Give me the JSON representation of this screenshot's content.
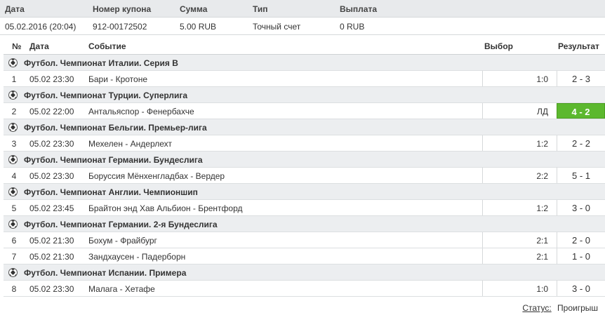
{
  "coupon": {
    "headers": {
      "date": "Дата",
      "number": "Номер купона",
      "sum": "Сумма",
      "type": "Тип",
      "payout": "Выплата"
    },
    "values": {
      "date": "05.02.2016 (20:04)",
      "number": "912-00172502",
      "sum": "5.00 RUB",
      "type": "Точный счет",
      "payout": "0 RUB"
    }
  },
  "events_table": {
    "headers": {
      "num": "№",
      "date": "Дата",
      "event": "Событие",
      "choice": "Выбор",
      "result": "Результат"
    },
    "groups": [
      {
        "title": "Футбол. Чемпионат Италии. Серия В",
        "matches": [
          {
            "num": "1",
            "date": "05.02 23:30",
            "event": "Бари - Кротоне",
            "choice": "1:0",
            "result": "2 - 3",
            "win": false
          }
        ]
      },
      {
        "title": "Футбол. Чемпионат Турции. Суперлига",
        "matches": [
          {
            "num": "2",
            "date": "05.02 22:00",
            "event": "Антальяспор - Фенербахче",
            "choice": "ЛД",
            "result": "4 - 2",
            "win": true
          }
        ]
      },
      {
        "title": "Футбол. Чемпионат Бельгии. Премьер-лига",
        "matches": [
          {
            "num": "3",
            "date": "05.02 23:30",
            "event": "Мехелен - Андерлехт",
            "choice": "1:2",
            "result": "2 - 2",
            "win": false
          }
        ]
      },
      {
        "title": "Футбол. Чемпионат Германии. Бундеслига",
        "matches": [
          {
            "num": "4",
            "date": "05.02 23:30",
            "event": "Боруссия Мёнхенгладбах - Вердер",
            "choice": "2:2",
            "result": "5 - 1",
            "win": false
          }
        ]
      },
      {
        "title": "Футбол. Чемпионат Англии. Чемпионшип",
        "matches": [
          {
            "num": "5",
            "date": "05.02 23:45",
            "event": "Брайтон энд Хав Альбион - Брентфорд",
            "choice": "1:2",
            "result": "3 - 0",
            "win": false
          }
        ]
      },
      {
        "title": "Футбол. Чемпионат Германии. 2-я Бундеслига",
        "matches": [
          {
            "num": "6",
            "date": "05.02 21:30",
            "event": "Бохум - Фрайбург",
            "choice": "2:1",
            "result": "2 - 0",
            "win": false
          },
          {
            "num": "7",
            "date": "05.02 21:30",
            "event": "Зандхаусен - Падерборн",
            "choice": "2:1",
            "result": "1 - 0",
            "win": false
          }
        ]
      },
      {
        "title": "Футбол. Чемпионат Испании. Примера",
        "matches": [
          {
            "num": "8",
            "date": "05.02 23:30",
            "event": "Малага - Хетафе",
            "choice": "1:0",
            "result": "3 - 0",
            "win": false
          }
        ]
      }
    ]
  },
  "status": {
    "label": "Статус:",
    "value": "Проигрыш"
  },
  "icons": {
    "sport": "soccer-ball-icon"
  },
  "colors": {
    "win_result_bg": "#5cb82e",
    "header_bg": "#e8eaec",
    "group_bg": "#eceef0"
  }
}
